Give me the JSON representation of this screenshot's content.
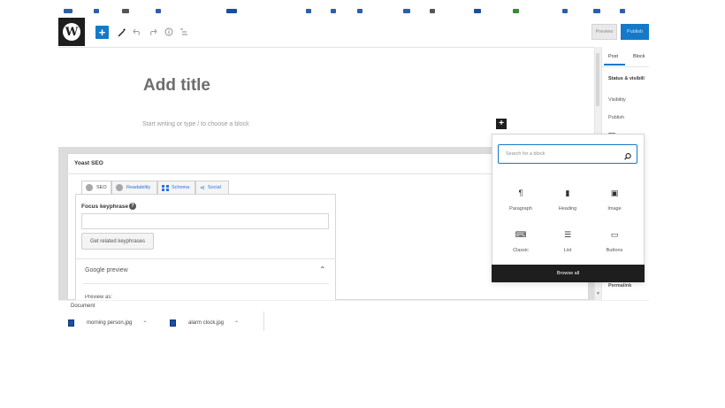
{
  "toolbar": {
    "logo_glyph": "W",
    "inserter_glyph": "+",
    "icons": [
      "pencil-icon",
      "undo-icon",
      "redo-icon",
      "info-icon",
      "list-view-icon"
    ],
    "preview_label": "Preview",
    "publish_label": "Publish"
  },
  "editor": {
    "title_placeholder": "Add title",
    "block_placeholder": "Start writing or type / to choose a block",
    "add_block_glyph": "+"
  },
  "yoast": {
    "title": "Yoast SEO",
    "tabs": [
      {
        "label": "SEO",
        "icon": "dot-icon"
      },
      {
        "label": "Readability",
        "icon": "dot-icon"
      },
      {
        "label": "Schema",
        "icon": "grid-icon"
      },
      {
        "label": "Social",
        "icon": "share-icon"
      }
    ],
    "focus_keyphrase_label": "Focus keyphrase",
    "help_glyph": "?",
    "focus_keyphrase_value": "",
    "related_button_label": "Get related keyphrases",
    "google_preview_label": "Google preview",
    "preview_as_label": "Preview as:"
  },
  "inserter": {
    "search_placeholder": "Search for a block",
    "blocks": [
      {
        "label": "Paragraph",
        "icon": "paragraph-icon",
        "glyph": "¶"
      },
      {
        "label": "Heading",
        "icon": "bookmark-icon",
        "glyph": "▮"
      },
      {
        "label": "Image",
        "icon": "image-icon",
        "glyph": "▣"
      },
      {
        "label": "Classic",
        "icon": "keyboard-icon",
        "glyph": "⌨"
      },
      {
        "label": "List",
        "icon": "list-icon",
        "glyph": "☰"
      },
      {
        "label": "Buttons",
        "icon": "button-icon",
        "glyph": "▭"
      }
    ],
    "browse_all_label": "Browse all"
  },
  "sidebar": {
    "tab_post": "Post",
    "tab_block": "Block",
    "status_heading": "Status & visibili",
    "visibility_label": "Visibility",
    "publish_label": "Publish",
    "permalink_label": "Permalink"
  },
  "downloads": {
    "label": "Document",
    "items": [
      {
        "name": "morning person.jpg"
      },
      {
        "name": "alarm clock.jpg"
      }
    ]
  },
  "colors": {
    "accent": "#1479c9",
    "dark": "#1e1e1e",
    "yoast_blue": "#2874d9"
  }
}
